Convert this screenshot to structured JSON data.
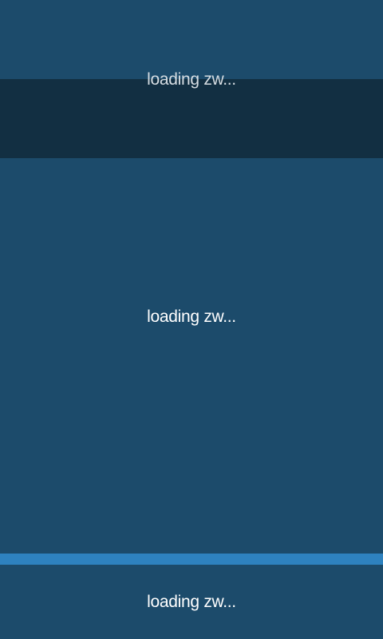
{
  "screen": {
    "top_panel": {
      "loading_text": "loading zw..."
    },
    "middle_panel": {
      "loading_text": "loading zw..."
    },
    "bottom_panel": {
      "loading_text": "loading zw..."
    }
  },
  "colors": {
    "background": "#1c4b6b",
    "dark_band": "#122f42",
    "accent_band": "#2e82bf",
    "text": "#ffffff"
  }
}
